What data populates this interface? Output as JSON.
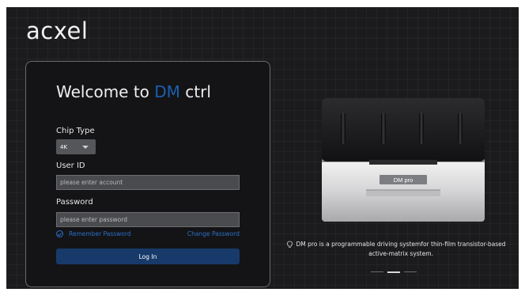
{
  "app": {
    "logo": "acxel",
    "colors": {
      "accent": "#1b5fb0",
      "link": "#2c6fc9",
      "button": "#173a6a",
      "background": "#1b1b1d"
    }
  },
  "login": {
    "welcome_prefix": "Welcome to ",
    "welcome_accent": "DM",
    "welcome_suffix": " ctrl",
    "chip_type_label": "Chip Type",
    "chip_type_value": "4K",
    "user_id_label": "User ID",
    "user_id_placeholder": "please enter account",
    "user_id_value": "",
    "password_label": "Password",
    "password_placeholder": "please enter password",
    "password_value": "",
    "remember_label": "Remember Password",
    "remember_checked": true,
    "change_password_label": "Change Password",
    "login_button_label": "Log In"
  },
  "showcase": {
    "device_label": "DM pro",
    "info_icon": "lightbulb-icon",
    "description": "DM pro is a programmable driving systemfor thin-film transistor-based active-matrix system.",
    "carousel": {
      "slide_count": 3,
      "active_index": 1
    }
  }
}
